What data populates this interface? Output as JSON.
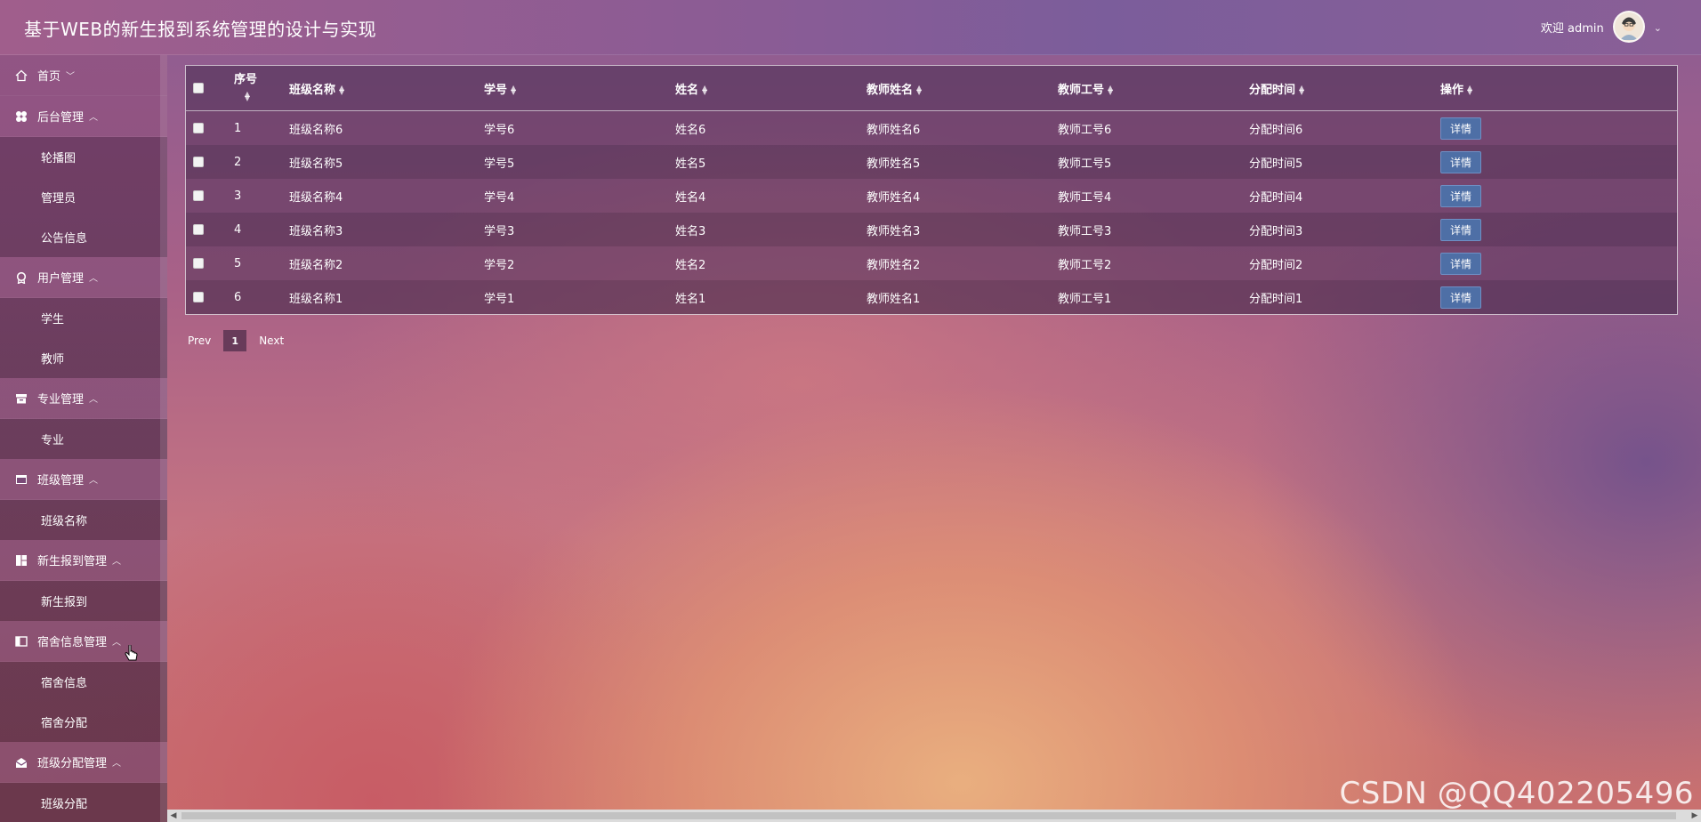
{
  "header": {
    "title": "基于WEB的新生报到系统管理的设计与实现",
    "welcome": "欢迎 admin"
  },
  "sidebar": {
    "items": [
      {
        "type": "group",
        "label": "首页",
        "icon": "home-icon",
        "chevron": "down"
      },
      {
        "type": "group",
        "label": "后台管理",
        "icon": "apps-icon",
        "chevron": "up"
      },
      {
        "type": "item",
        "label": "轮播图"
      },
      {
        "type": "item",
        "label": "管理员"
      },
      {
        "type": "item",
        "label": "公告信息"
      },
      {
        "type": "group",
        "label": "用户管理",
        "icon": "badge-icon",
        "chevron": "up"
      },
      {
        "type": "item",
        "label": "学生"
      },
      {
        "type": "item",
        "label": "教师"
      },
      {
        "type": "group",
        "label": "专业管理",
        "icon": "archive-icon",
        "chevron": "up"
      },
      {
        "type": "item",
        "label": "专业"
      },
      {
        "type": "group",
        "label": "班级管理",
        "icon": "window-icon",
        "chevron": "up"
      },
      {
        "type": "item",
        "label": "班级名称"
      },
      {
        "type": "group",
        "label": "新生报到管理",
        "icon": "dashboard-icon",
        "chevron": "up"
      },
      {
        "type": "item",
        "label": "新生报到"
      },
      {
        "type": "group",
        "label": "宿舍信息管理",
        "icon": "layout-icon",
        "chevron": "up"
      },
      {
        "type": "item",
        "label": "宿舍信息"
      },
      {
        "type": "item",
        "label": "宿舍分配"
      },
      {
        "type": "group",
        "label": "班级分配管理",
        "icon": "mail-open-icon",
        "chevron": "up"
      },
      {
        "type": "item",
        "label": "班级分配"
      }
    ]
  },
  "table": {
    "columns": [
      "序号",
      "班级名称",
      "学号",
      "姓名",
      "教师姓名",
      "教师工号",
      "分配时间",
      "操作"
    ],
    "action_label": "详情",
    "rows": [
      [
        "1",
        "班级名称6",
        "学号6",
        "姓名6",
        "教师姓名6",
        "教师工号6",
        "分配时间6"
      ],
      [
        "2",
        "班级名称5",
        "学号5",
        "姓名5",
        "教师姓名5",
        "教师工号5",
        "分配时间5"
      ],
      [
        "3",
        "班级名称4",
        "学号4",
        "姓名4",
        "教师姓名4",
        "教师工号4",
        "分配时间4"
      ],
      [
        "4",
        "班级名称3",
        "学号3",
        "姓名3",
        "教师姓名3",
        "教师工号3",
        "分配时间3"
      ],
      [
        "5",
        "班级名称2",
        "学号2",
        "姓名2",
        "教师姓名2",
        "教师工号2",
        "分配时间2"
      ],
      [
        "6",
        "班级名称1",
        "学号1",
        "姓名1",
        "教师姓名1",
        "教师工号1",
        "分配时间1"
      ]
    ]
  },
  "pagination": {
    "prev": "Prev",
    "current": "1",
    "next": "Next"
  },
  "watermark": "CSDN @QQ402205496",
  "colors": {
    "button_bg": "#4e6fa6"
  }
}
